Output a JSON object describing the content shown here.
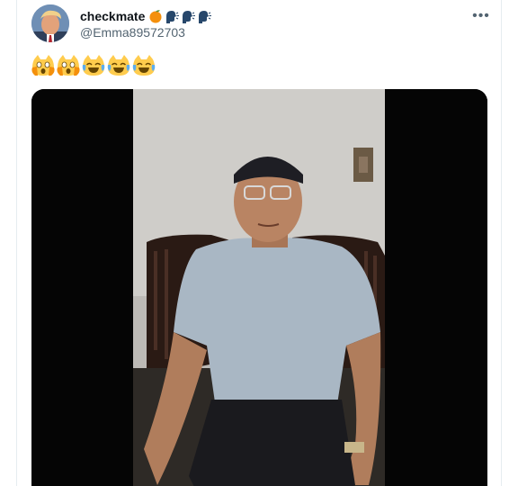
{
  "tweet": {
    "display_name": "checkmate",
    "handle": "@Emma89572703",
    "name_emojis": [
      "orange-emoji",
      "speaking-head-emoji",
      "speaking-head-emoji",
      "speaking-head-emoji"
    ],
    "text_emojis": [
      "scream-cat-emoji",
      "scream-cat-emoji",
      "joy-cat-emoji",
      "joy-cat-emoji",
      "joy-cat-emoji"
    ],
    "more_label": "•••"
  },
  "colors": {
    "name_text": "#0f1419",
    "secondary_text": "#536471",
    "media_bg": "#050505"
  }
}
